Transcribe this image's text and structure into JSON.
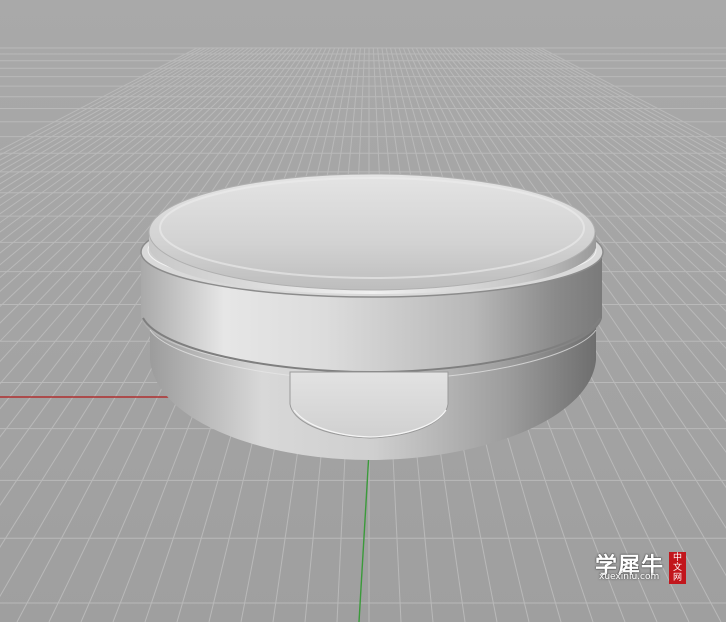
{
  "viewport": {
    "view_type": "perspective",
    "grid_visible": true,
    "object": "round compact case",
    "colors": {
      "background": "#a4a4a4",
      "grid_line": "#b8b8b8",
      "x_axis": "#b03030",
      "y_axis": "#3a9a3a"
    }
  },
  "watermark": {
    "main": "学犀牛",
    "url": "xuexiniu.com",
    "badge": "中文网"
  }
}
